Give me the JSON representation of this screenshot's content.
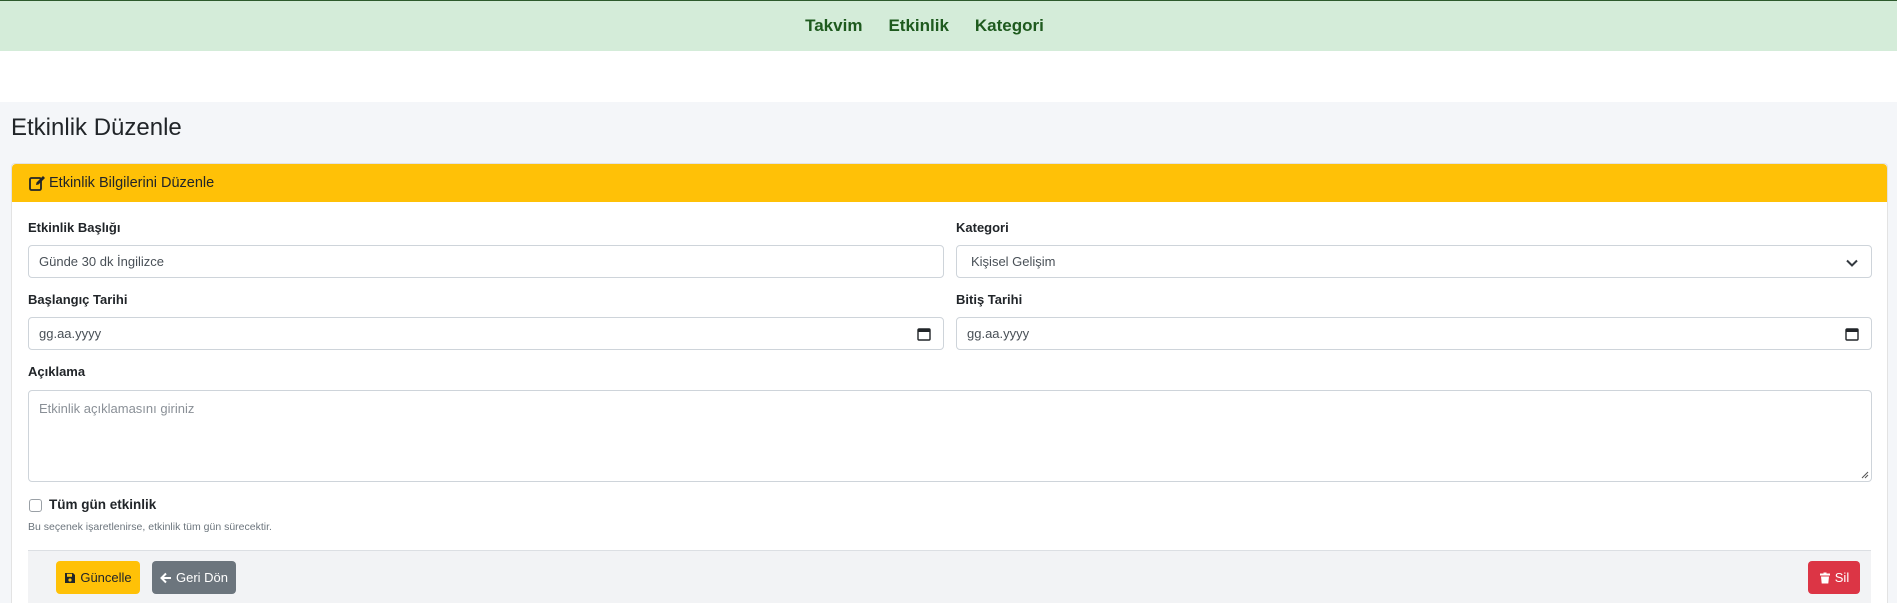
{
  "nav": {
    "items": [
      "Takvim",
      "Etkinlik",
      "Kategori"
    ]
  },
  "page": {
    "title": "Etkinlik Düzenle"
  },
  "card": {
    "header": "Etkinlik Bilgilerini Düzenle",
    "fields": {
      "title": {
        "label": "Etkinlik Başlığı",
        "value": "Günde 30 dk İngilizce"
      },
      "category": {
        "label": "Kategori",
        "value": "Kişisel Gelişim"
      },
      "start_date": {
        "label": "Başlangıç Tarihi",
        "placeholder": "gg.aa.yyyy"
      },
      "end_date": {
        "label": "Bitiş Tarihi",
        "placeholder": "gg.aa.yyyy"
      },
      "description": {
        "label": "Açıklama",
        "placeholder": "Etkinlik açıklamasını giriniz"
      },
      "all_day": {
        "label": "Tüm gün etkinlik",
        "help": "Bu seçenek işaretlenirse, etkinlik tüm gün sürecektir.",
        "checked": false
      }
    },
    "buttons": {
      "update": "Güncelle",
      "back": "Geri Dön",
      "delete": "Sil"
    }
  },
  "colors": {
    "nav_bg": "#d4ecd9",
    "nav_text": "#1e5a1e",
    "header_bg": "#ffc107",
    "update_bg": "#ffc107",
    "back_bg": "#6c757d",
    "delete_bg": "#dc3545"
  },
  "icons": {
    "header": "edit-icon",
    "date": "calendar-icon",
    "select": "chevron-down-icon",
    "update": "save-icon",
    "back": "arrow-left-icon",
    "delete": "trash-icon"
  }
}
